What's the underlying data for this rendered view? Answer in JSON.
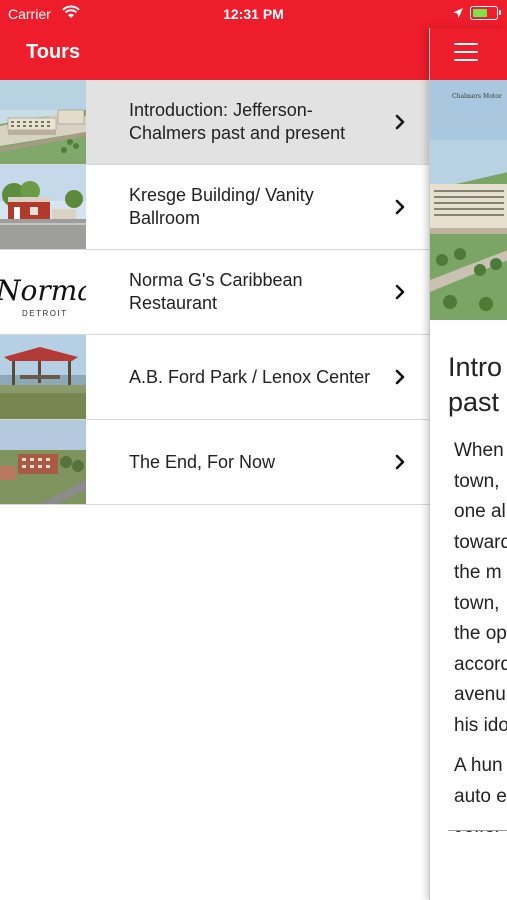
{
  "status_bar": {
    "carrier": "Carrier",
    "time": "12:31 PM"
  },
  "nav": {
    "title": "Tours"
  },
  "tours": [
    {
      "title": "Introduction: Jefferson-Chalmers past and present",
      "selected": true
    },
    {
      "title": "Kresge Building/ Vanity Ballroom",
      "selected": false
    },
    {
      "title": "Norma G's Caribbean Restaurant",
      "selected": false
    },
    {
      "title": "A.B. Ford Park / Lenox Center",
      "selected": false
    },
    {
      "title": "The End, For Now",
      "selected": false
    }
  ],
  "thumbnails": {
    "norma_logo_text": "Norma G",
    "norma_logo_sub": "DETROIT"
  },
  "detail": {
    "image_caption": "Chalmers Motor",
    "title": "Intro\npast",
    "paragraphs": [
      "When\ntown,\none al\ntoward\nthe m\ntown,\nthe op\naccord\navenu\nhis ido",
      "A hun\nauto e\nJeffer"
    ]
  },
  "colors": {
    "brand_red": "#ee1d2b",
    "selected_row": "#e2e2e2",
    "divider": "#d8d8d8"
  },
  "icons": [
    "wifi-icon",
    "location-arrow-icon",
    "battery-icon",
    "chevron-right-icon",
    "hamburger-menu-icon"
  ]
}
